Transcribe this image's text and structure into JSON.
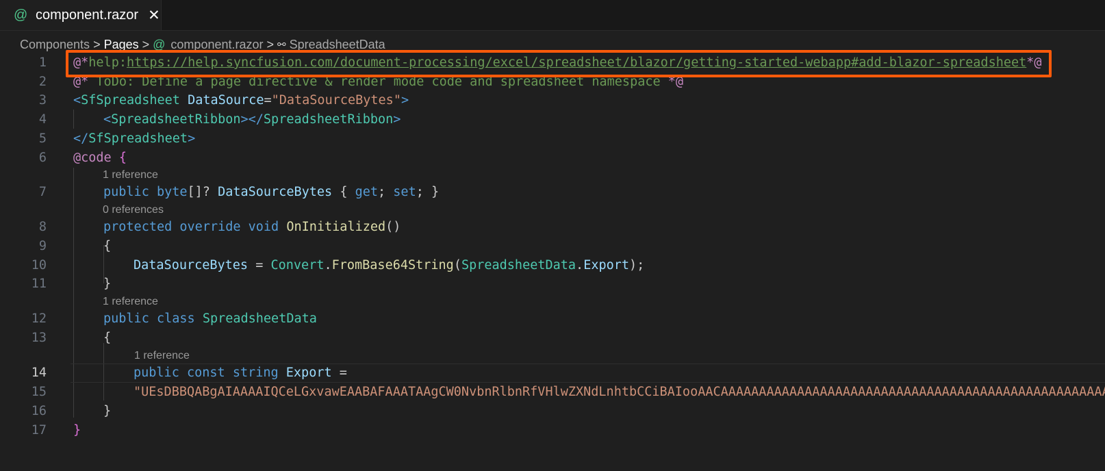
{
  "tab": {
    "icon": "at-sign-icon",
    "title": "component.razor",
    "close": "✕"
  },
  "breadcrumb": {
    "items": [
      "Components",
      "Pages",
      "component.razor",
      "SpreadsheetData"
    ],
    "at_symbol": "@",
    "separator": ">"
  },
  "lines": [
    {
      "n": "1"
    },
    {
      "n": "2"
    },
    {
      "n": "3"
    },
    {
      "n": "4"
    },
    {
      "n": "5"
    },
    {
      "n": "6"
    },
    {
      "n": "7"
    },
    {
      "n": "8"
    },
    {
      "n": "9"
    },
    {
      "n": "10"
    },
    {
      "n": "11"
    },
    {
      "n": "12"
    },
    {
      "n": "13"
    },
    {
      "n": "14"
    },
    {
      "n": "15"
    },
    {
      "n": "16"
    },
    {
      "n": "17"
    }
  ],
  "code": {
    "l1_open": "@*",
    "l1_help": "help:",
    "l1_url": "https://help.syncfusion.com/document-processing/excel/spreadsheet/blazor/getting-started-webapp#add-blazor-spreadsheet",
    "l1_close": "*@",
    "l2_open": "@*",
    "l2_text": " ToDo: Define a page directive & render mode code and spreadsheet namespace ",
    "l2_close": "*@",
    "l3_lt": "<",
    "l3_tag": "SfSpreadsheet",
    "l3_attr": "DataSource",
    "l3_eq": "=",
    "l3_val": "\"DataSourceBytes\"",
    "l3_gt": ">",
    "l4_open": "<",
    "l4_tag": "SpreadsheetRibbon",
    "l4_mid": "></",
    "l4_tag2": "SpreadsheetRibbon",
    "l4_close": ">",
    "l5_open": "</",
    "l5_tag": "SfSpreadsheet",
    "l5_close": ">",
    "l6_code": "@code",
    "l6_brace": "{",
    "lens_1": "1 reference",
    "l7_public": "public",
    "l7_byte": "byte",
    "l7_arr": "[]?",
    "l7_name": "DataSourceBytes",
    "l7_open": "{",
    "l7_get": "get",
    "l7_semi1": ";",
    "l7_set": "set",
    "l7_semi2": ";",
    "l7_close": "}",
    "lens_0": "0 references",
    "l8_protected": "protected",
    "l8_override": "override",
    "l8_void": "void",
    "l8_name": "OnInitialized",
    "l8_parens": "()",
    "l9_brace": "{",
    "l10_prop": "DataSourceBytes",
    "l10_eq": " = ",
    "l10_convert": "Convert",
    "l10_dot": ".",
    "l10_fn": "FromBase64String",
    "l10_paren": "(",
    "l10_cls": "SpreadsheetData",
    "l10_dot2": ".",
    "l10_export": "Export",
    "l10_end": ");",
    "l11_brace": "}",
    "lens_2": "1 reference",
    "l12_public": "public",
    "l12_class": "class",
    "l12_name": "SpreadsheetData",
    "l13_brace": "{",
    "lens_3": "1 reference",
    "l14_public": "public",
    "l14_const": "const",
    "l14_string": "string",
    "l14_name": "Export",
    "l14_eq": " =",
    "l15_str": "\"UEsDBBQABgAIAAAAIQCeLGxvawEAABAFAAATAAgCW0NvbnRlbnRfVHlwZXNdLnhtbCCiBAIooAACAAAAAAAAAAAAAAAAAAAAAAAAAAAAAAAAAAAAAAAAAAAAAAAAAAA",
    "l16_brace": "}",
    "l17_brace": "}"
  },
  "colors": {
    "highlight_border": "#ff5a0a",
    "background": "#1f1f1f"
  }
}
